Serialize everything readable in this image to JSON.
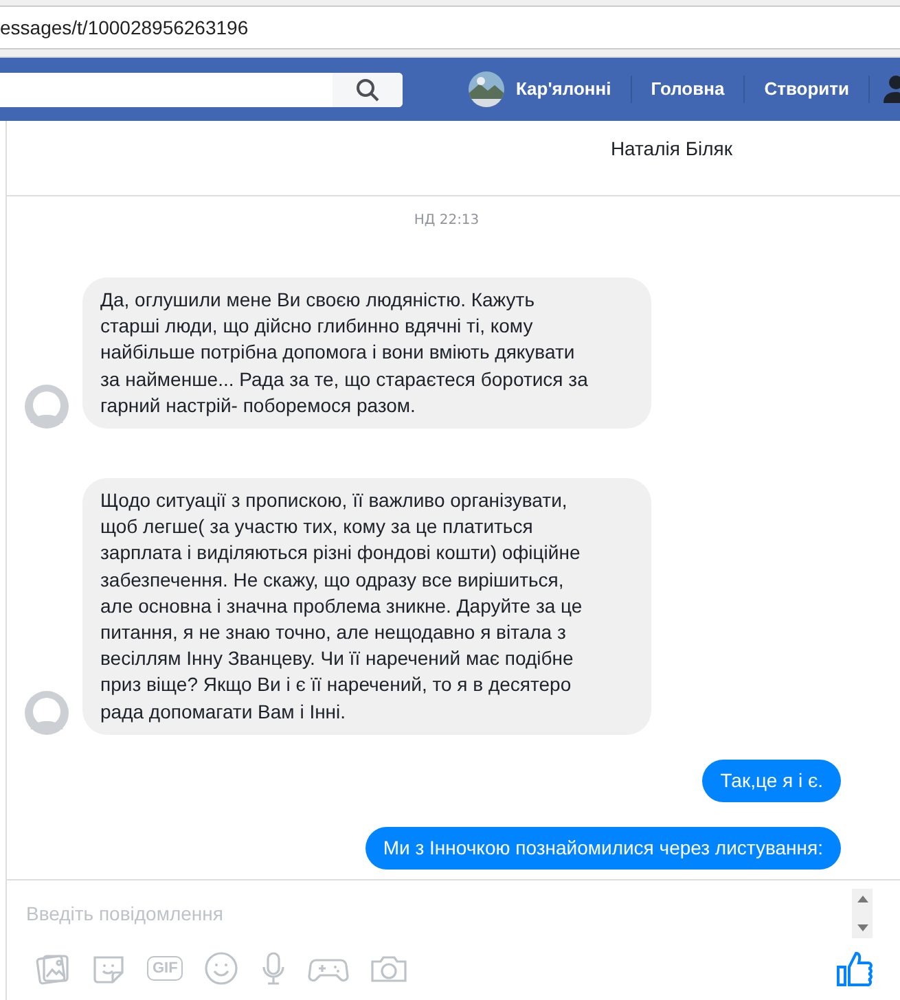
{
  "address_bar": {
    "url": "essages/t/100028956263196"
  },
  "top_bar": {
    "profile_name": "Кар'ялонні",
    "nav": [
      "Головна",
      "Створити"
    ]
  },
  "conversation": {
    "title": "Наталія Біляк",
    "date": "НД 22:13",
    "messages": [
      {
        "kind": "incoming",
        "lines": [
          "Да, оглушили мене Ви своєю людяністю. Кажуть",
          "старші люди, що дійсно глибинно вдячні ті, кому",
          "найбільше потрібна допомога і вони вміють дякувати",
          "за найменше... Рада за те, що стараєтеся боротися за",
          "гарний настрій- поборемося разом."
        ]
      },
      {
        "kind": "incoming",
        "lines": [
          "Щодо ситуації з пропискою, її важливо організувати,",
          "щоб легше( за участю тих, кому за це платиться",
          "зарплата і виділяються різні фондові кошти) офіційне",
          "забезпечення. Не скажу, що одразу все вирішиться,",
          "але основна і значна проблема зникне. Даруйте за це",
          "питання, я не знаю точно, але нещодавно я вітала з",
          "весіллям Інну Званцеву. Чи її наречений має подібне",
          "приз віще? Якщо Ви і є її наречений, то я в десятеро",
          "рада допомагати Вам і Інні."
        ]
      },
      {
        "kind": "outgoing",
        "lines": [
          "Так,це я і є."
        ]
      },
      {
        "kind": "outgoing",
        "lines": [
          "Ми з Інночкою познайомилися через листування:"
        ]
      }
    ]
  },
  "composer": {
    "placeholder": "Введіть повідомлення",
    "gif_label": "GIF"
  }
}
